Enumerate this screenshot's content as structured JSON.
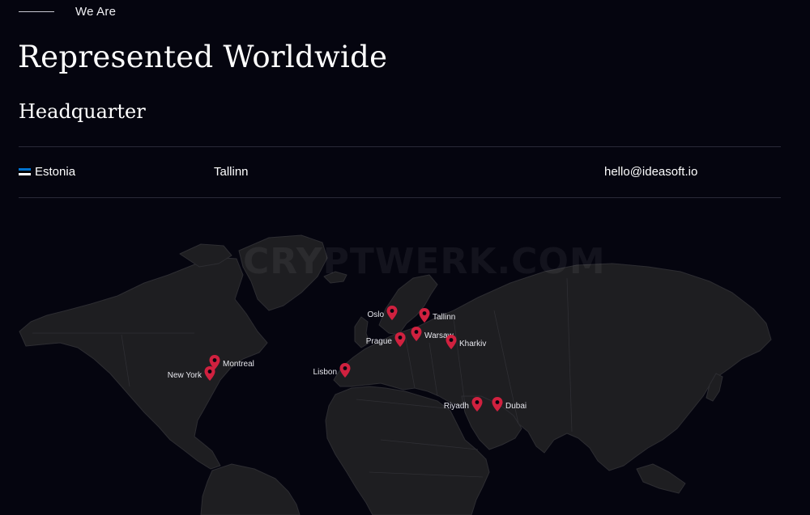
{
  "header": {
    "eyebrow": "We Are",
    "title": "Represented Worldwide"
  },
  "headquarter": {
    "title": "Headquarter",
    "country": "Estonia",
    "city": "Tallinn",
    "email": "hello@ideasoft.io",
    "flag_colors": [
      "#0072CE",
      "#000000",
      "#FFFFFF"
    ]
  },
  "map": {
    "watermark": "CRYPTWERK.COM",
    "pin_color": "#d0213f",
    "land_color": "#1e1e21",
    "locations": [
      {
        "name": "Oslo"
      },
      {
        "name": "Tallinn"
      },
      {
        "name": "Warsaw"
      },
      {
        "name": "Prague"
      },
      {
        "name": "Kharkiv"
      },
      {
        "name": "Montreal"
      },
      {
        "name": "New York"
      },
      {
        "name": "Lisbon"
      },
      {
        "name": "Riyadh"
      },
      {
        "name": "Dubai"
      }
    ]
  }
}
